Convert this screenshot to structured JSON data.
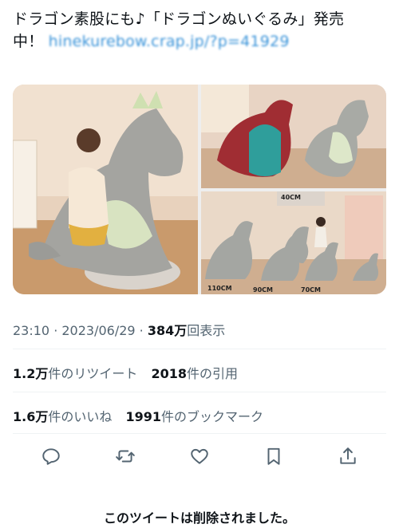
{
  "tweet": {
    "text_line1": "ドラゴン素股にも♪「ドラゴンぬいぐるみ」発売",
    "text_line2_prefix": "中！",
    "link": "hinekurebow.crap.jp/?p=41929"
  },
  "media": {
    "size_labels": [
      "40CM",
      "110CM",
      "90CM",
      "70CM"
    ]
  },
  "meta": {
    "time": "23:10",
    "separator1": " · ",
    "date": "2023/06/29",
    "separator2": " · ",
    "views_count": "384万",
    "views_label": "回表示"
  },
  "stats": {
    "retweets_count": "1.2万",
    "retweets_label": "件のリツイート",
    "quotes_count": "2018",
    "quotes_label": "件の引用",
    "likes_count": "1.6万",
    "likes_label": "件のいいね",
    "bookmarks_count": "1991",
    "bookmarks_label": "件のブックマーク"
  },
  "actions": [
    "reply-icon",
    "retweet-icon",
    "like-icon",
    "bookmark-icon",
    "share-icon"
  ],
  "notice": "このツイートは削除されました。"
}
